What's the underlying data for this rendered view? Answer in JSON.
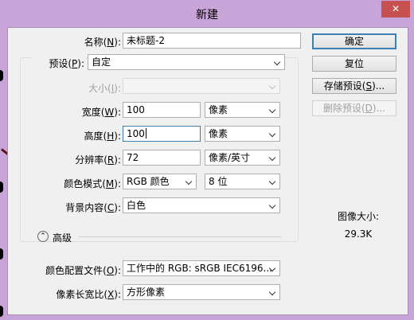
{
  "window": {
    "title": "新建",
    "close_glyph": "✕"
  },
  "form": {
    "name": {
      "label_pre": "名称(",
      "key": "N",
      "label_post": "):",
      "value": "未标题-2"
    },
    "preset": {
      "label_pre": "预设(",
      "key": "P",
      "label_post": "):",
      "value": "自定"
    },
    "size": {
      "label_pre": "大小(",
      "key": "I",
      "label_post": "):",
      "value": ""
    },
    "width": {
      "label_pre": "宽度(",
      "key": "W",
      "label_post": "):",
      "value": "100",
      "unit": "像素"
    },
    "height": {
      "label_pre": "高度(",
      "key": "H",
      "label_post": "):",
      "value": "100",
      "unit": "像素"
    },
    "resolution": {
      "label_pre": "分辨率(",
      "key": "R",
      "label_post": "):",
      "value": "72",
      "unit": "像素/英寸"
    },
    "color_mode": {
      "label_pre": "颜色模式(",
      "key": "M",
      "label_post": "):",
      "value": "RGB 颜色",
      "depth": "8 位"
    },
    "background": {
      "label_pre": "背景内容(",
      "key": "C",
      "label_post": "):",
      "value": "白色"
    },
    "advanced": {
      "label": "高级",
      "icon": "⌃"
    },
    "color_profile": {
      "label_pre": "颜色配置文件(",
      "key": "O",
      "label_post": "):",
      "value": "工作中的 RGB: sRGB IEC6196..."
    },
    "pixel_aspect": {
      "label_pre": "像素长宽比(",
      "key": "X",
      "label_post": "):",
      "value": "方形像素"
    }
  },
  "buttons": {
    "ok": "确定",
    "reset": "复位",
    "save_preset": {
      "pre": "存储预设(",
      "key": "S",
      "post": ")..."
    },
    "delete_preset": {
      "pre": "删除预设(",
      "key": "D",
      "post": ")..."
    }
  },
  "image_size": {
    "label": "图像大小:",
    "value": "29.3K"
  },
  "colors": {
    "frame": "#c8a4d8",
    "panel": "#f0f0f0",
    "close": "#c75050",
    "focus": "#3c7fb1"
  }
}
